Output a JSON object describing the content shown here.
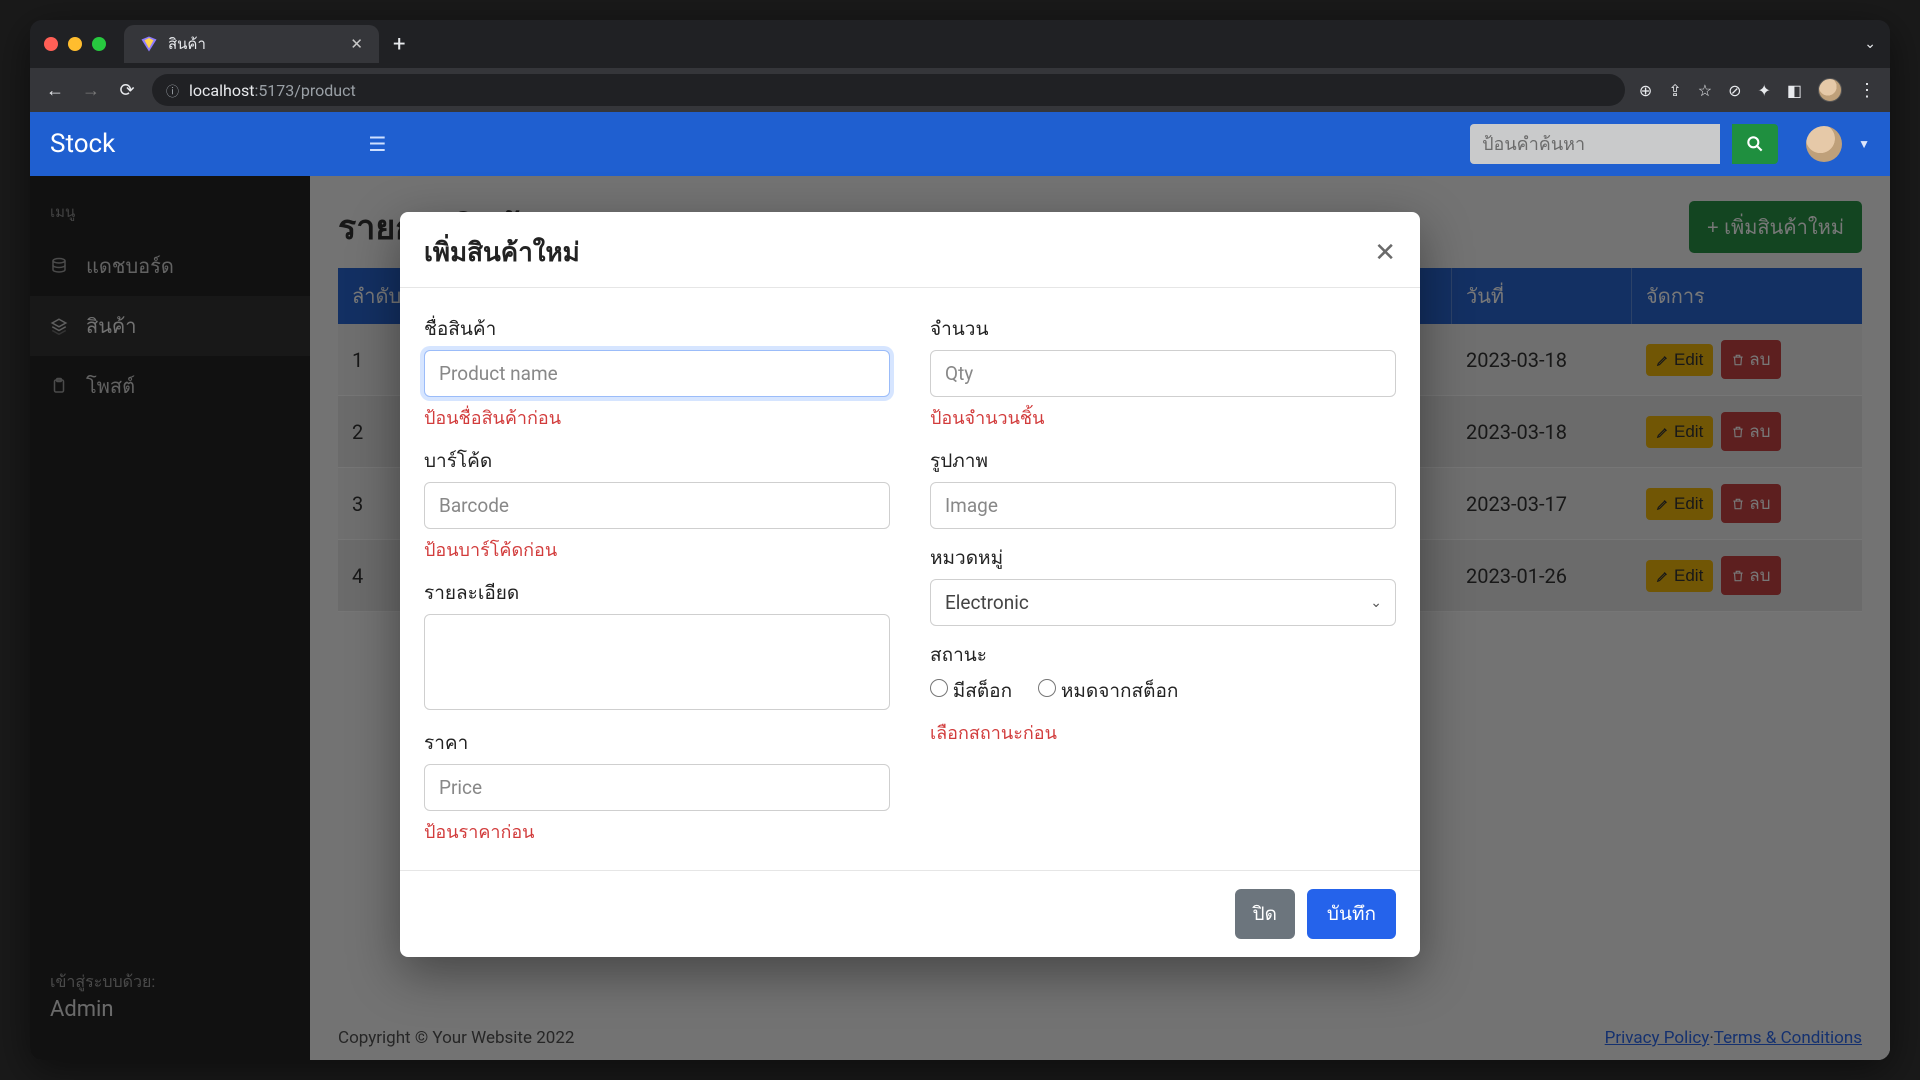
{
  "browser": {
    "tab_title": "สินค้า",
    "url_prefix": "localhost",
    "url_rest": ":5173/product"
  },
  "header": {
    "brand": "Stock",
    "search_placeholder": "ป้อนคำค้นหา"
  },
  "sidebar": {
    "section_label": "เมนู",
    "items": [
      {
        "label": "แดชบอร์ด",
        "icon": "database-icon"
      },
      {
        "label": "สินค้า",
        "icon": "layers-icon"
      },
      {
        "label": "โพสต์",
        "icon": "clipboard-icon"
      }
    ],
    "footer_line1": "เข้าสู่ระบบด้วย:",
    "footer_line2": "Admin"
  },
  "page": {
    "title": "รายการสินค้า",
    "add_button": "+ เพิ่มสินค้าใหม่",
    "columns": {
      "col1": "ลำดับ",
      "col5": "วันที่",
      "col6": "จัดการ"
    },
    "rows": [
      {
        "idx": "1",
        "date": "2023-03-18"
      },
      {
        "idx": "2",
        "date": "2023-03-18"
      },
      {
        "idx": "3",
        "date": "2023-03-17"
      },
      {
        "idx": "4",
        "date": "2023-01-26"
      }
    ],
    "edit_label": "Edit",
    "delete_label": "ลบ"
  },
  "footer": {
    "copyright": "Copyright © Your Website 2022",
    "privacy": "Privacy Policy",
    "sep": "·",
    "terms": "Terms & Conditions"
  },
  "modal": {
    "title": "เพิ่มสินค้าใหม่",
    "fields": {
      "name_label": "ชื่อสินค้า",
      "name_ph": "Product name",
      "name_err": "ป้อนชื่อสินค้าก่อน",
      "barcode_label": "บาร์โค้ด",
      "barcode_ph": "Barcode",
      "barcode_err": "ป้อนบาร์โค้ดก่อน",
      "desc_label": "รายละเอียด",
      "price_label": "ราคา",
      "price_ph": "Price",
      "price_err": "ป้อนราคาก่อน",
      "qty_label": "จำนวน",
      "qty_ph": "Qty",
      "qty_err": "ป้อนจำนวนชิ้น",
      "image_label": "รูปภาพ",
      "image_ph": "Image",
      "cat_label": "หมวดหมู่",
      "cat_value": "Electronic",
      "status_label": "สถานะ",
      "status_instock": "มีสต็อก",
      "status_outstock": "หมดจากสต็อก",
      "status_err": "เลือกสถานะก่อน"
    },
    "close_btn": "ปิด",
    "save_btn": "บันทึก"
  }
}
